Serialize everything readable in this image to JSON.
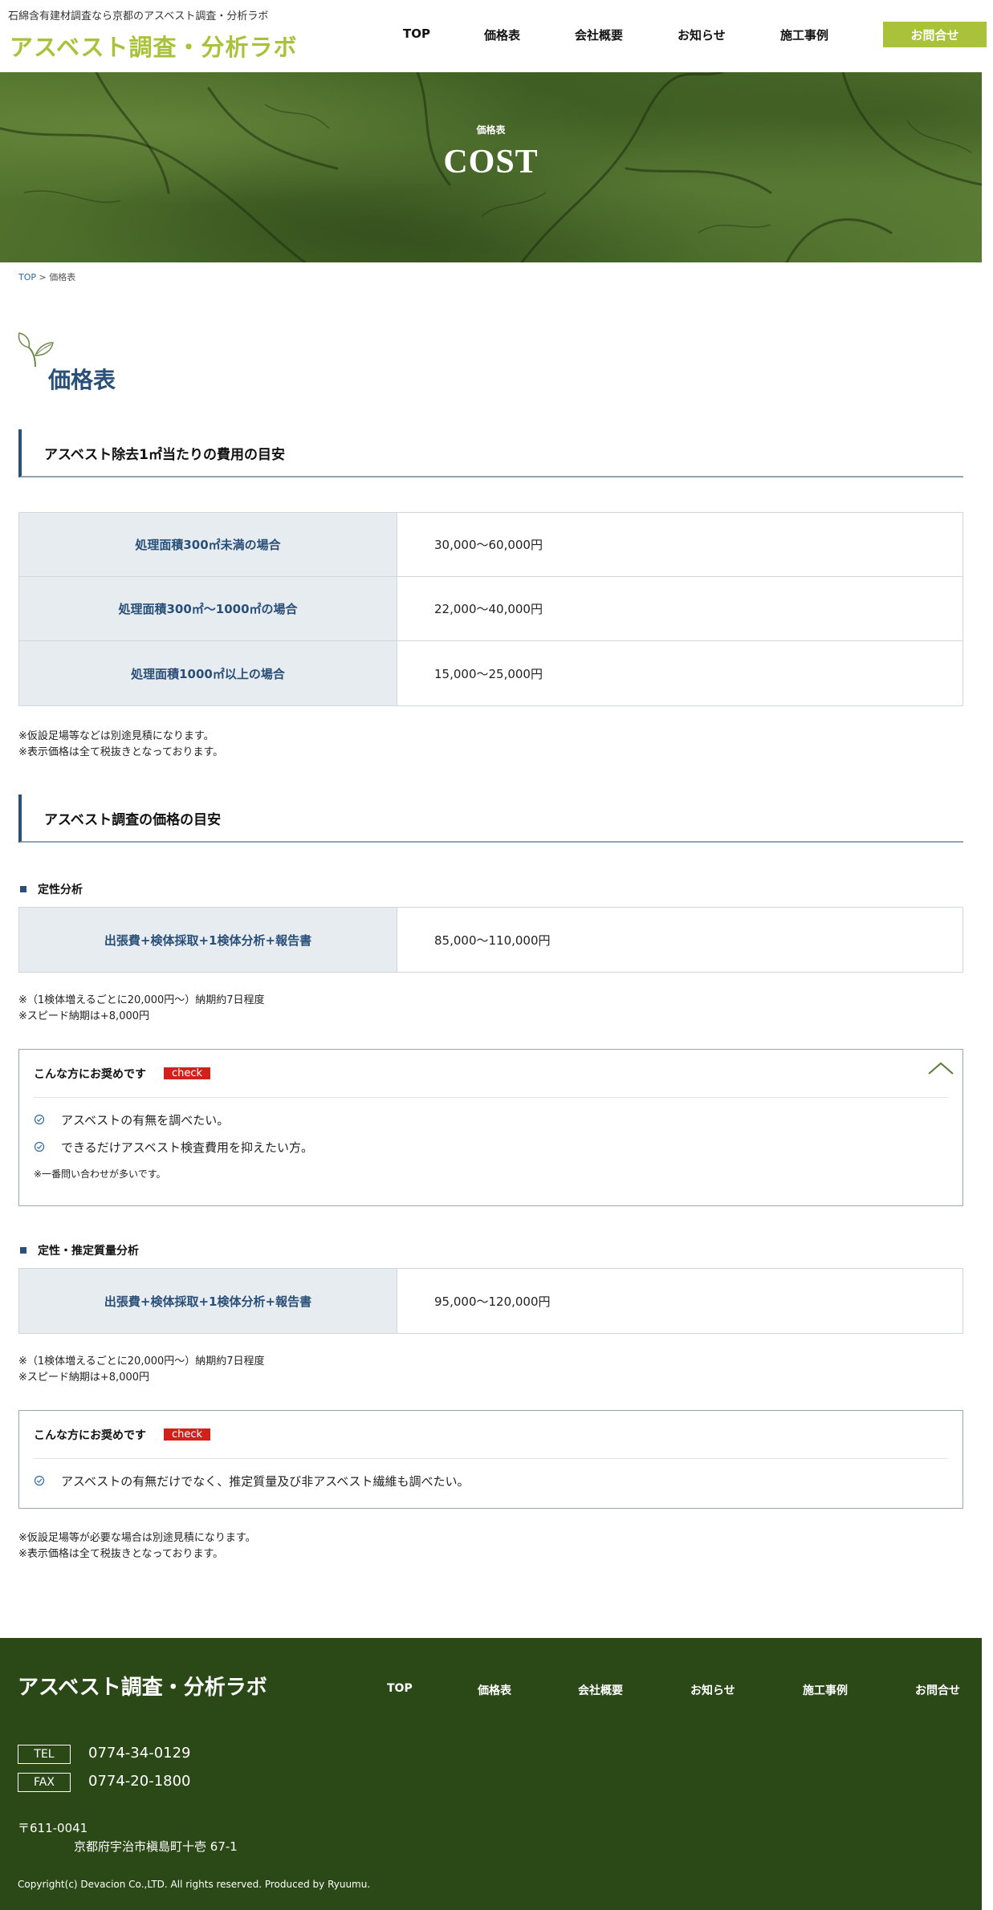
{
  "header": {
    "tagline": "石綿含有建材調査なら京都のアスベスト調査・分析ラボ",
    "logo": "アスベスト調査・分析ラボ",
    "nav": [
      "TOP",
      "価格表",
      "会社概要",
      "お知らせ",
      "施工事例"
    ],
    "contact": "お問合せ"
  },
  "hero": {
    "sub": "価格表",
    "title": "COST"
  },
  "breadcrumb": {
    "home": "TOP",
    "separator": ">",
    "current": "価格表"
  },
  "page_title": "価格表",
  "removal": {
    "heading": "アスベスト除去1㎡当たりの費用の目安",
    "rows": [
      {
        "label": "処理面積300㎡未満の場合",
        "value": "30,000～60,000円"
      },
      {
        "label": "処理面積300㎡～1000㎡の場合",
        "value": "22,000～40,000円"
      },
      {
        "label": "処理面積1000㎡以上の場合",
        "value": "15,000～25,000円"
      }
    ],
    "notes": [
      "※仮設足場等などは別途見積になります。",
      "※表示価格は全て税抜きとなっております。"
    ]
  },
  "survey": {
    "heading": "アスベスト調査の価格の目安",
    "qualitative": {
      "title": "定性分析",
      "row": {
        "label": "出張費+検体採取+1検体分析+報告書",
        "value": "85,000～110,000円"
      },
      "notes": [
        "※（1検体増えるごとに20,000円～）納期約7日程度",
        "※スピード納期は+8,000円"
      ],
      "recommend": {
        "title": "こんな方にお奨めです",
        "badge": "check",
        "items": [
          "アスベストの有無を調べたい。",
          "できるだけアスベスト検査費用を抑えたい方。"
        ],
        "note": "※一番問い合わせが多いです。"
      }
    },
    "quantitative": {
      "title": "定性・推定質量分析",
      "row": {
        "label": "出張費+検体採取+1検体分析+報告書",
        "value": "95,000～120,000円"
      },
      "notes": [
        "※（1検体増えるごとに20,000円～）納期約7日程度",
        "※スピード納期は+8,000円"
      ],
      "recommend": {
        "title": "こんな方にお奨めです",
        "badge": "check",
        "items": [
          "アスベストの有無だけでなく、推定質量及び非アスベスト繊維も調べたい。"
        ]
      }
    },
    "final_notes": [
      "※仮設足場等が必要な場合は別途見積になります。",
      "※表示価格は全て税抜きとなっております。"
    ]
  },
  "footer": {
    "logo": "アスベスト調査・分析ラボ",
    "nav": [
      "TOP",
      "価格表",
      "会社概要",
      "お知らせ",
      "施工事例",
      "お問合せ"
    ],
    "tel_label": "TEL",
    "tel": "0774-34-0129",
    "fax_label": "FAX",
    "fax": "0774-20-1800",
    "zip": "〒611-0041",
    "address": "京都府宇治市槇島町十壱 67-1",
    "copyright": "Copyright(c) Devacion Co.,LTD. All rights reserved. Produced by Ryuumu."
  },
  "colors": {
    "accent": "#a9c23a",
    "navy": "#2a4f78",
    "footer_bg": "#2b4817",
    "badge": "#d0221a",
    "table_label_bg": "#e6ecf0"
  },
  "icons": {
    "leaf": "leaf-icon",
    "check": "check-circle-icon",
    "chevron": "chevron-up-icon"
  }
}
